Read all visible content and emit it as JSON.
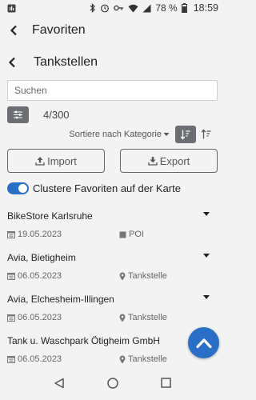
{
  "status": {
    "battery_percent": "78 %",
    "time": "18:59"
  },
  "header1": {
    "title": "Favoriten"
  },
  "header2": {
    "title": "Tankstellen"
  },
  "search": {
    "placeholder": "Suchen"
  },
  "filter": {
    "count": "4/300"
  },
  "sort": {
    "label": "Sortiere nach Kategorie"
  },
  "buttons": {
    "import_label": "Import",
    "export_label": "Export"
  },
  "toggle": {
    "label": "Clustere Favoriten auf der Karte",
    "on": true
  },
  "items": [
    {
      "name": "BikeStore Karlsruhe",
      "date": "19.05.2023",
      "category": "POI",
      "category_icon": "poi-square-icon"
    },
    {
      "name": "Avia, Bietigheim",
      "date": "06.05.2023",
      "category": "Tankstelle",
      "category_icon": "pin-icon"
    },
    {
      "name": "Avia, Elchesheim-Illingen",
      "date": "06.05.2023",
      "category": "Tankstelle",
      "category_icon": "pin-icon"
    },
    {
      "name": "Tank u. Waschpark Ötigheim GmbH",
      "date": "06.05.2023",
      "category": "Tankstelle",
      "category_icon": "pin-icon"
    }
  ],
  "colors": {
    "accent": "#2a6fc7",
    "button_dark": "#6b6e73",
    "background": "#f3f3f3"
  }
}
